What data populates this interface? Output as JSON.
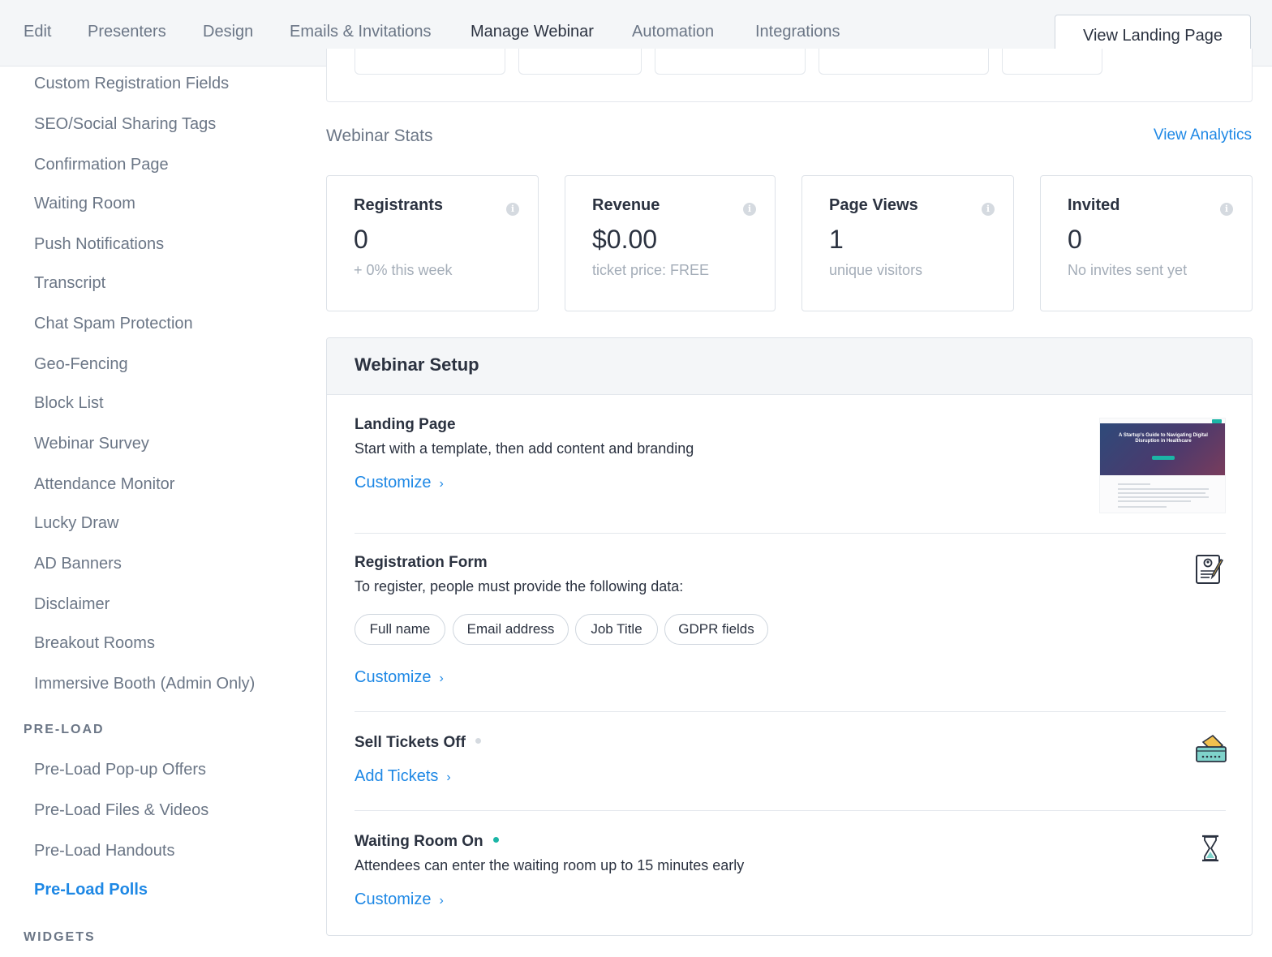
{
  "nav": {
    "tabs": [
      {
        "label": "Edit"
      },
      {
        "label": "Presenters"
      },
      {
        "label": "Design"
      },
      {
        "label": "Emails & Invitations"
      },
      {
        "label": "Manage Webinar"
      },
      {
        "label": "Automation"
      },
      {
        "label": "Integrations"
      }
    ],
    "active_tab": "Manage Webinar",
    "view_landing_label": "View Landing Page"
  },
  "sidebar": {
    "items": [
      {
        "label": "Custom Registration Fields"
      },
      {
        "label": "SEO/Social Sharing Tags"
      },
      {
        "label": "Confirmation Page"
      },
      {
        "label": "Waiting Room"
      },
      {
        "label": "Push Notifications"
      },
      {
        "label": "Transcript"
      },
      {
        "label": "Chat Spam Protection"
      },
      {
        "label": "Geo-Fencing"
      },
      {
        "label": "Block List"
      },
      {
        "label": "Webinar Survey"
      },
      {
        "label": "Attendance Monitor"
      },
      {
        "label": "Lucky Draw"
      },
      {
        "label": "AD Banners"
      },
      {
        "label": "Disclaimer"
      },
      {
        "label": "Breakout Rooms"
      },
      {
        "label": "Immersive Booth (Admin Only)"
      }
    ],
    "preload_section": "PRE-LOAD",
    "preload_items": [
      {
        "label": "Pre-Load Pop-up Offers"
      },
      {
        "label": "Pre-Load Files & Videos"
      },
      {
        "label": "Pre-Load Handouts"
      },
      {
        "label": "Pre-Load Polls"
      }
    ],
    "active_item": "Pre-Load Polls",
    "widgets_section": "WIDGETS"
  },
  "stats": {
    "title": "Webinar Stats",
    "view_analytics": "View Analytics",
    "cards": [
      {
        "label": "Registrants",
        "value": "0",
        "sub": "+ 0% this week"
      },
      {
        "label": "Revenue",
        "value": "$0.00",
        "sub": "ticket price: FREE"
      },
      {
        "label": "Page Views",
        "value": "1",
        "sub": "unique visitors"
      },
      {
        "label": "Invited",
        "value": "0",
        "sub": "No invites sent yet"
      }
    ]
  },
  "setup": {
    "title": "Webinar Setup",
    "landing": {
      "title": "Landing Page",
      "desc": "Start with a template, then add content and branding",
      "link": "Customize",
      "thumb_title": "A Startup's Guide to Navigating Digital Disruption in Healthcare"
    },
    "registration": {
      "title": "Registration Form",
      "desc": "To register, people must provide the following data:",
      "fields": [
        "Full name",
        "Email address",
        "Job Title",
        "GDPR fields"
      ],
      "link": "Customize"
    },
    "tickets": {
      "title": "Sell Tickets Off",
      "link": "Add Tickets"
    },
    "waiting": {
      "title": "Waiting Room On",
      "desc": "Attendees can enter the waiting room up to 15 minutes early",
      "link": "Customize"
    }
  },
  "colors": {
    "accent": "#1e88e5",
    "status_on": "#1bb5a6",
    "status_off": "#d5dae0",
    "text_primary": "#2b3240",
    "text_muted": "#6b7686"
  }
}
